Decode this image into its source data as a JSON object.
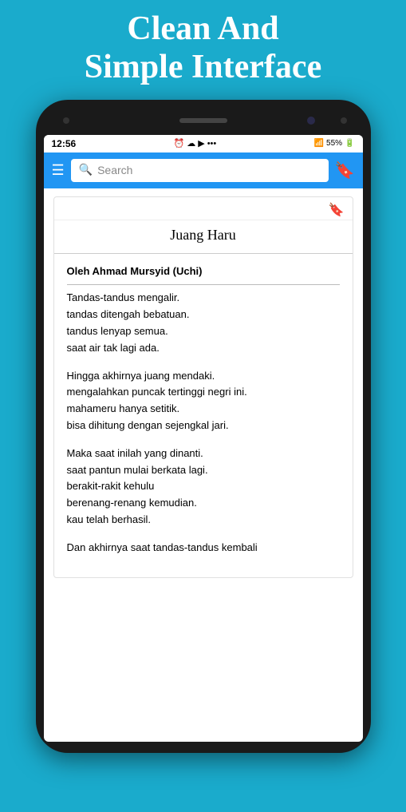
{
  "header": {
    "line1": "Clean And",
    "line2": "Simple Interface"
  },
  "status_bar": {
    "time": "12:56",
    "battery": "55%",
    "signal": "4G"
  },
  "toolbar": {
    "search_placeholder": "Search",
    "hamburger_label": "☰",
    "bookmark_label": "🔖"
  },
  "poem": {
    "title": "Juang Haru",
    "author": "Oleh Ahmad Mursyid (Uchi)",
    "stanzas": [
      {
        "lines": [
          "Tandas-tandus mengalir.",
          "tandas ditengah bebatuan.",
          "tandus lenyap semua.",
          "saat air tak lagi ada."
        ]
      },
      {
        "lines": [
          "Hingga akhirnya juang mendaki.",
          "mengalahkan puncak tertinggi negri ini.",
          "mahameru hanya setitik.",
          "bisa dihitung dengan sejengkal jari."
        ]
      },
      {
        "lines": [
          "Maka saat inilah yang dinanti.",
          "saat pantun mulai berkata lagi.",
          "berakit-rakit kehulu",
          "berenang-renang kemudian.",
          "kau telah berhasil."
        ]
      },
      {
        "lines": [
          "Dan akhirnya saat tandas-tandus kembali"
        ]
      }
    ]
  },
  "colors": {
    "background": "#1AABCC",
    "toolbar": "#2196F3",
    "text_dark": "#111111"
  }
}
